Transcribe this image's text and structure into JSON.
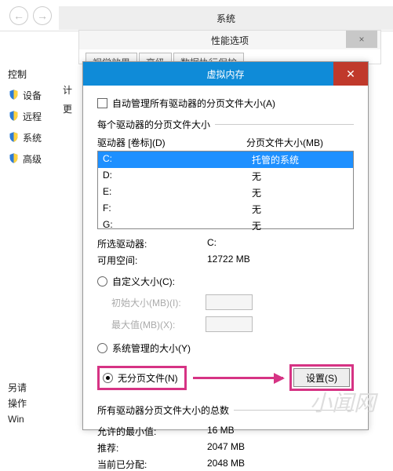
{
  "nav": {
    "back_glyph": "←",
    "fwd_glyph": "→"
  },
  "sys_bar": {
    "title": "系统"
  },
  "perf": {
    "title": "性能选项",
    "close_glyph": "×",
    "tabs": [
      "视觉效果",
      "高级",
      "数据执行保护"
    ]
  },
  "left": {
    "heading": "控制",
    "items": [
      "设备",
      "远程",
      "系统",
      "高级"
    ],
    "sub1": "计",
    "sub2": "更",
    "footer_lines": [
      "另请",
      "操作",
      "Win"
    ]
  },
  "vm": {
    "title": "虚拟内存",
    "close_glyph": "✕",
    "auto_manage_label": "自动管理所有驱动器的分页文件大小(A)",
    "group_each_drive": "每个驱动器的分页文件大小",
    "col_drive": "驱动器 [卷标](D)",
    "col_size": "分页文件大小(MB)",
    "drives": [
      {
        "letter": "C:",
        "size": "托管的系统",
        "selected": true
      },
      {
        "letter": "D:",
        "size": "无",
        "selected": false
      },
      {
        "letter": "E:",
        "size": "无",
        "selected": false
      },
      {
        "letter": "F:",
        "size": "无",
        "selected": false
      },
      {
        "letter": "G:",
        "size": "无",
        "selected": false
      }
    ],
    "selected_drive_label": "所选驱动器:",
    "selected_drive_value": "C:",
    "avail_label": "可用空间:",
    "avail_value": "12722 MB",
    "radio_custom": "自定义大小(C):",
    "init_label": "初始大小(MB)(I):",
    "max_label": "最大值(MB)(X):",
    "radio_system": "系统管理的大小(Y)",
    "radio_none": "无分页文件(N)",
    "set_btn": "设置(S)",
    "totals_label": "所有驱动器分页文件大小的总数",
    "allowed_min_label": "允许的最小值:",
    "allowed_min_value": "16 MB",
    "recommended_label": "推荐:",
    "recommended_value": "2047 MB",
    "current_label": "当前已分配:",
    "current_value": "2048 MB"
  },
  "watermark": "小闻网"
}
